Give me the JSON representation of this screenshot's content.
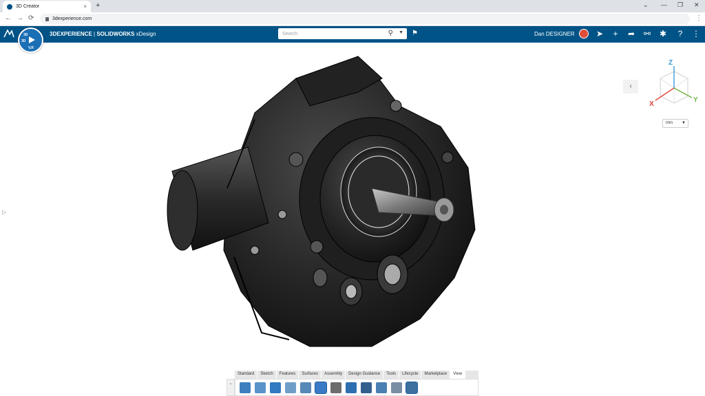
{
  "browser": {
    "tab_title": "3D Creator",
    "tab_close": "×",
    "new_tab": "+",
    "url": "3dexperience.com",
    "win_min": "⌄",
    "win_min2": "—",
    "win_restore": "❐",
    "win_close": "✕",
    "menu": "⋮",
    "back": "←",
    "forward": "→",
    "reload": "⟳"
  },
  "app": {
    "brand_bold": "3DEXPERIENCE",
    "brand_sep": " | ",
    "brand_product": "SOLIDWORKS",
    "brand_suffix": " xDesign",
    "compass_labels": {
      "top": "3D",
      "left": "3D",
      "bottom": "V,R"
    },
    "search_placeholder": "Search",
    "user_name": "Dan DESIGNER"
  },
  "viewport": {
    "unit": "mm",
    "triad": {
      "z": "Z",
      "x": "X",
      "y": "Y"
    }
  },
  "command_bar": {
    "tabs": [
      "Standard",
      "Sketch",
      "Features",
      "Surfaces",
      "Assembly",
      "Design Guidance",
      "Tools",
      "Lifecycle",
      "Marketplace",
      "View"
    ],
    "active_tab": "View"
  },
  "colors": {
    "app_bar": "#005386",
    "compass": "#1b6fb5",
    "avatar": "#e04e39"
  }
}
